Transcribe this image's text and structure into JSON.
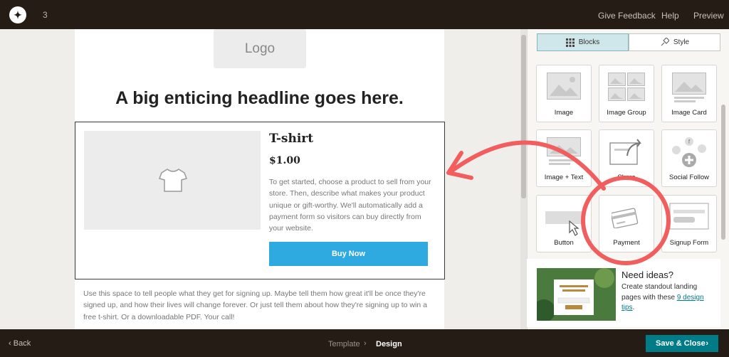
{
  "topbar": {
    "step_number": "3",
    "give_feedback": "Give Feedback",
    "help": "Help",
    "preview": "Preview"
  },
  "email": {
    "logo_placeholder": "Logo",
    "headline": "A big enticing headline goes here.",
    "product": {
      "name": "T-shirt",
      "price": "$1.00",
      "description": "To get started, choose a product to sell from your store. Then, describe what makes your product unique or gift-worthy. We'll automatically add a payment form so visitors can buy directly from your website.",
      "button": "Buy Now"
    },
    "body_text": "Use this space to tell people what they get for signing up. Maybe tell them how great it'll be once they're signed up, and how their lives will change forever. Or just tell them about how they're signing up to win a free t-shirt. Or a downloadable PDF. Your call!"
  },
  "panel": {
    "tabs": [
      {
        "label": "Blocks",
        "icon": "grid-icon",
        "active": true
      },
      {
        "label": "Style",
        "icon": "paint-icon",
        "active": false
      }
    ],
    "blocks": [
      {
        "label": "Image",
        "icon": "image-icon"
      },
      {
        "label": "Image Group",
        "icon": "image-group-icon"
      },
      {
        "label": "Image Card",
        "icon": "image-card-icon"
      },
      {
        "label": "Image + Text",
        "icon": "image-text-icon"
      },
      {
        "label": "Share",
        "icon": "share-icon"
      },
      {
        "label": "Social Follow",
        "icon": "social-follow-icon"
      },
      {
        "label": "Button",
        "icon": "button-icon"
      },
      {
        "label": "Payment",
        "icon": "credit-card-icon"
      },
      {
        "label": "Signup Form",
        "icon": "signup-form-icon"
      }
    ],
    "ideas": {
      "title": "Need ideas?",
      "text_before": "Create standout landing pages with these ",
      "link": "9 design tips",
      "text_after": "."
    }
  },
  "bottombar": {
    "back": "Back",
    "crumb_template": "Template",
    "crumb_design": "Design",
    "save": "Save & Close"
  },
  "colors": {
    "bar_bg": "#241c15",
    "accent_teal": "#007c89",
    "buy_button": "#2eaae1",
    "highlight_red": "#f25d5d",
    "tab_active": "#cfe6ea"
  }
}
